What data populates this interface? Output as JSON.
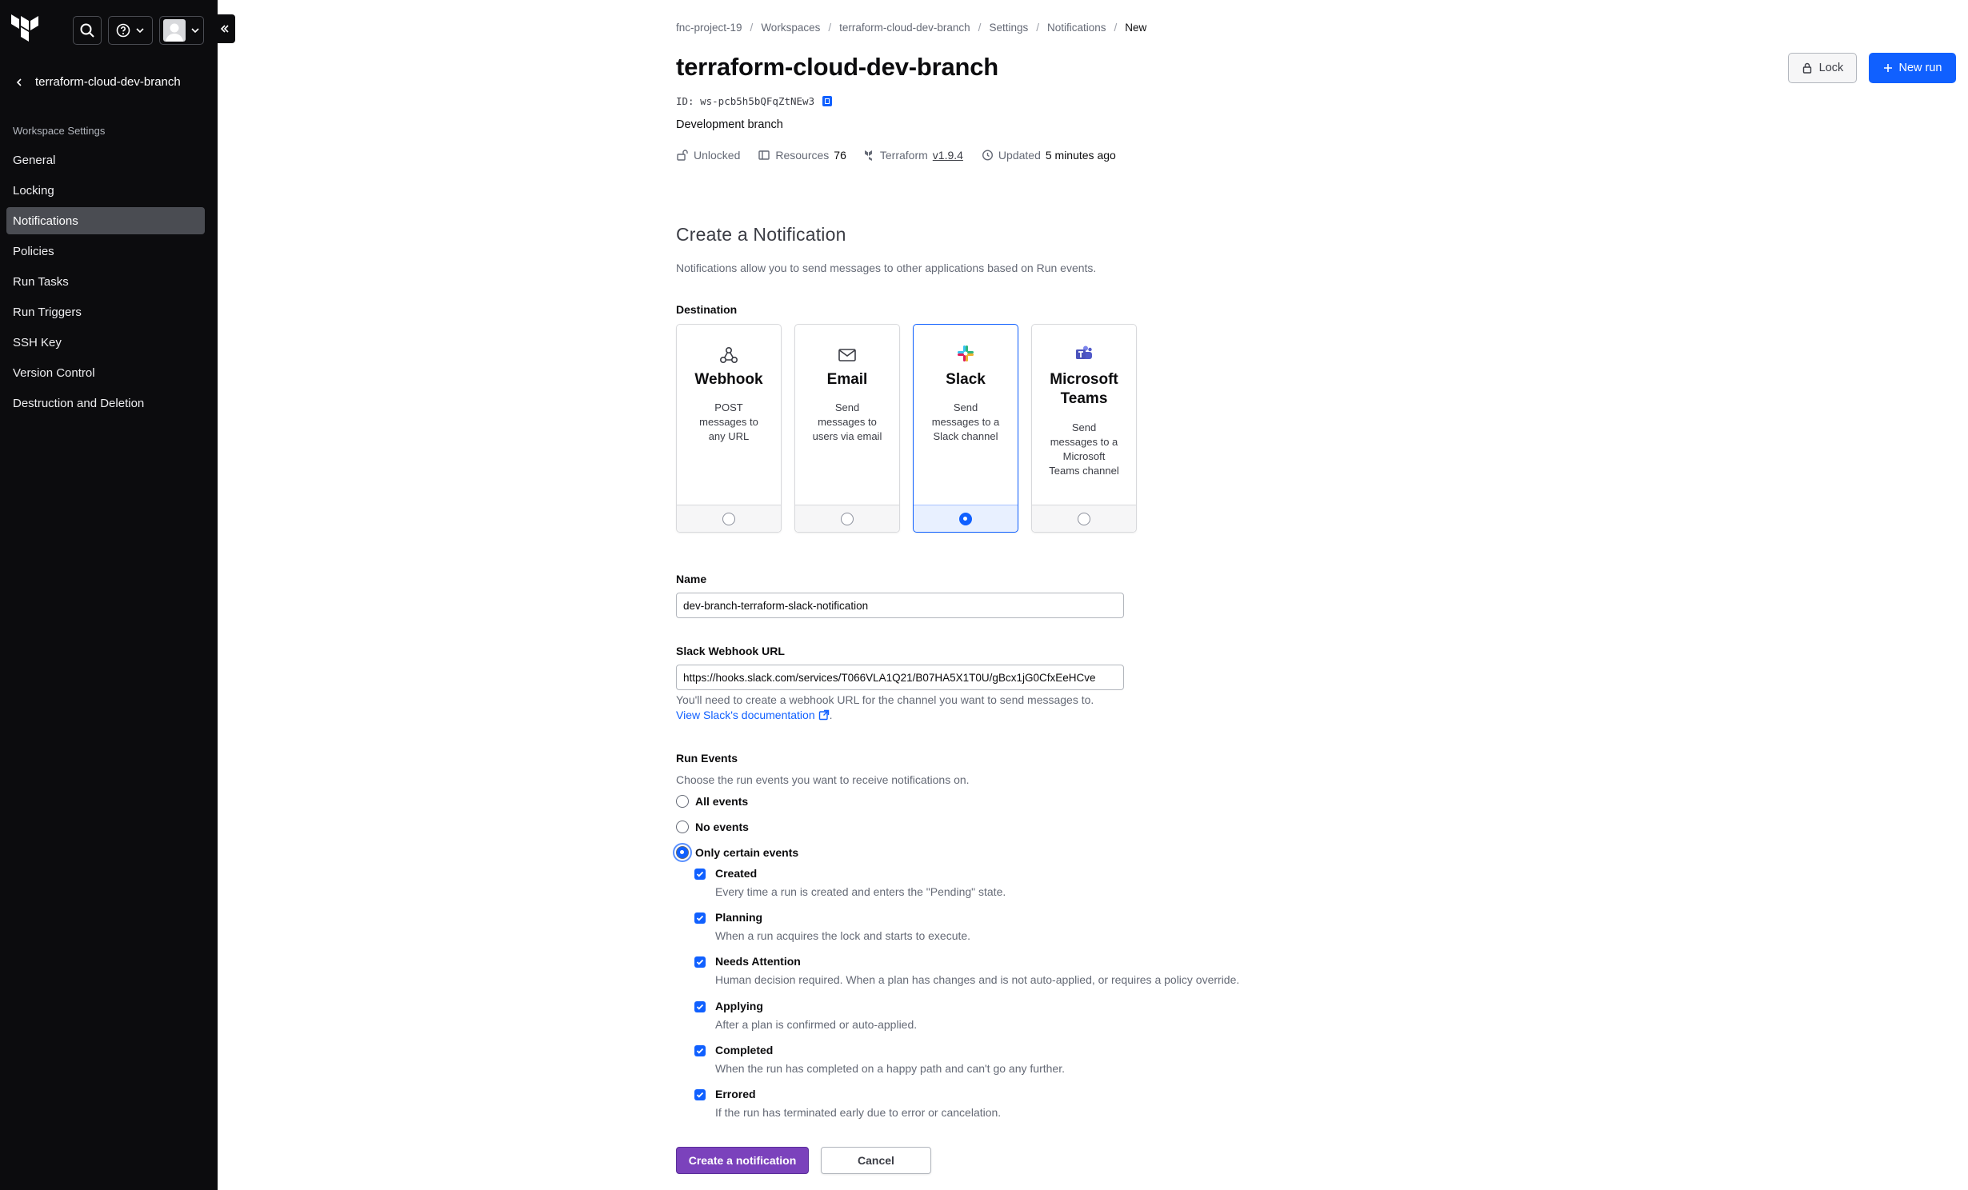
{
  "sidebar": {
    "back_label": "terraform-cloud-dev-branch",
    "section_heading": "Workspace Settings",
    "items": [
      {
        "label": "General"
      },
      {
        "label": "Locking"
      },
      {
        "label": "Notifications"
      },
      {
        "label": "Policies"
      },
      {
        "label": "Run Tasks"
      },
      {
        "label": "Run Triggers"
      },
      {
        "label": "SSH Key"
      },
      {
        "label": "Version Control"
      },
      {
        "label": "Destruction and Deletion"
      }
    ],
    "active_item": "Notifications"
  },
  "breadcrumb": [
    "fnc-project-19",
    "Workspaces",
    "terraform-cloud-dev-branch",
    "Settings",
    "Notifications",
    "New"
  ],
  "workspace": {
    "title": "terraform-cloud-dev-branch",
    "id_label": "ID:",
    "id_value": "ws-pcb5h5bQFqZtNEw3",
    "description": "Development branch",
    "lock_status": "Unlocked",
    "resources_label": "Resources",
    "resources_count": "76",
    "terraform_label": "Terraform",
    "terraform_version": "v1.9.4",
    "updated_label": "Updated",
    "updated_value": "5 minutes ago"
  },
  "actions": {
    "lock_label": "Lock",
    "new_run_label": "New run"
  },
  "form": {
    "title": "Create a Notification",
    "description": "Notifications allow you to send messages to other applications based on Run events.",
    "destination_label": "Destination",
    "destinations": [
      {
        "title": "Webhook",
        "desc": "POST messages to any URL",
        "selected": false
      },
      {
        "title": "Email",
        "desc": "Send messages to users via email",
        "selected": false
      },
      {
        "title": "Slack",
        "desc": "Send messages to a Slack channel",
        "selected": true
      },
      {
        "title": "Microsoft Teams",
        "desc": "Send messages to a Microsoft Teams channel",
        "selected": false
      }
    ],
    "name_label": "Name",
    "name_value": "dev-branch-terraform-slack-notification",
    "url_label": "Slack Webhook URL",
    "url_value": "https://hooks.slack.com/services/T066VLA1Q21/B07HA5X1T0U/gBcx1jG0CfxEeHCve",
    "url_helper": "You'll need to create a webhook URL for the channel you want to send messages to.",
    "url_link": "View Slack's documentation",
    "run_events_label": "Run Events",
    "run_events_desc": "Choose the run events you want to receive notifications on.",
    "event_options": [
      {
        "label": "All events",
        "checked": false
      },
      {
        "label": "No events",
        "checked": false
      },
      {
        "label": "Only certain events",
        "checked": true
      }
    ],
    "events": [
      {
        "title": "Created",
        "desc": "Every time a run is created and enters the \"Pending\" state.",
        "checked": true
      },
      {
        "title": "Planning",
        "desc": "When a run acquires the lock and starts to execute.",
        "checked": true
      },
      {
        "title": "Needs Attention",
        "desc": "Human decision required. When a plan has changes and is not auto-applied, or requires a policy override.",
        "checked": true
      },
      {
        "title": "Applying",
        "desc": "After a plan is confirmed or auto-applied.",
        "checked": true
      },
      {
        "title": "Completed",
        "desc": "When the run has completed on a happy path and can't go any further.",
        "checked": true
      },
      {
        "title": "Errored",
        "desc": "If the run has terminated early due to error or cancelation.",
        "checked": true
      }
    ],
    "create_label": "Create a notification",
    "cancel_label": "Cancel"
  },
  "colors": {
    "sidebar_bg": "#0c0c0e",
    "primary_blue": "#1060ff",
    "create_purple": "#7b42bc"
  }
}
